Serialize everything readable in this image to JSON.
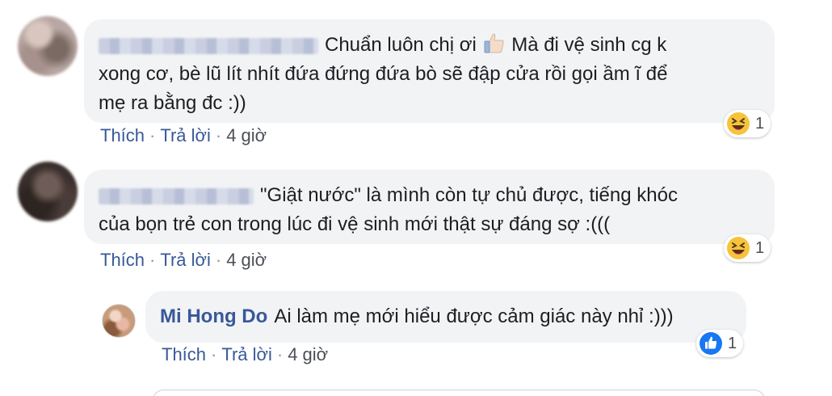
{
  "comments": [
    {
      "text": "Chuẩn luôn chị ơi",
      "text_cont": "Mà đi vệ sinh cg k",
      "line2": "xong cơ, bè lũ lít nhít đứa đứng đứa bò sẽ đập cửa rồi gọi ầm ĩ để",
      "line3": "mẹ ra bằng đc :))",
      "emoji": "thumbs-up-emoji",
      "actions": {
        "like": "Thích",
        "reply": "Trả lời",
        "time": "4 giờ"
      },
      "reaction": {
        "icon": "laugh-icon",
        "count": "1"
      }
    },
    {
      "text": "\"Giật nước\" là mình còn tự chủ được, tiếng khóc",
      "line2": "của bọn trẻ con trong lúc đi vệ sinh mới thật sự đáng sợ :(((",
      "actions": {
        "like": "Thích",
        "reply": "Trả lời",
        "time": "4 giờ"
      },
      "reaction": {
        "icon": "laugh-icon",
        "count": "1"
      }
    },
    {
      "name": "Mi Hong Do",
      "text": "Ai làm mẹ mới hiểu được cảm giác này nhỉ :)))",
      "actions": {
        "like": "Thích",
        "reply": "Trả lời",
        "time": "4 giờ"
      },
      "reaction": {
        "icon": "like-icon",
        "count": "1"
      }
    }
  ],
  "separator": "·",
  "colors": {
    "link": "#385898",
    "bubble": "#f2f3f5",
    "like_blue": "#1877f2",
    "laugh_yellow": "#f7c33b"
  }
}
